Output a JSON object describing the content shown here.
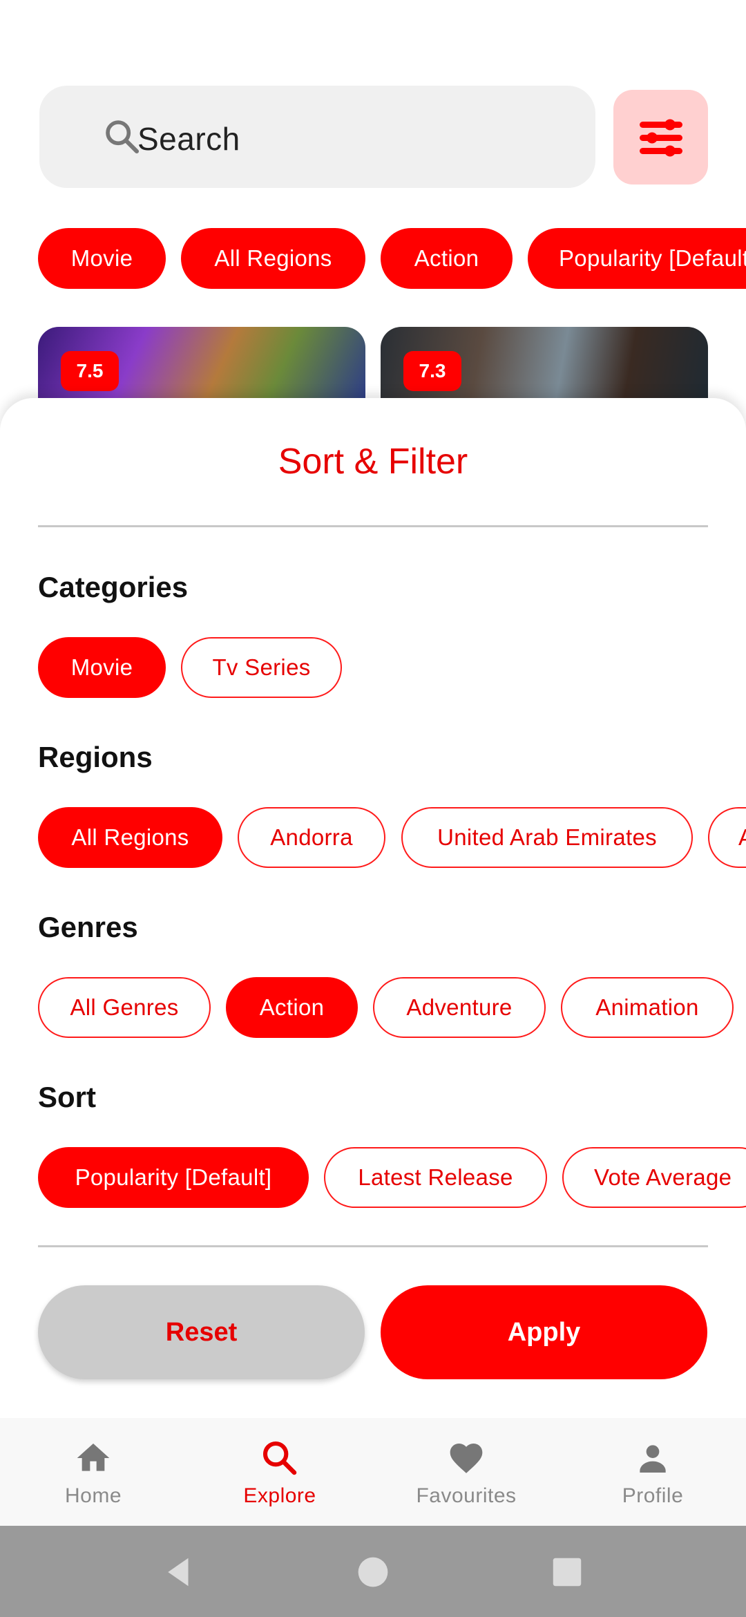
{
  "search": {
    "placeholder": "Search"
  },
  "active_filters": [
    "Movie",
    "All Regions",
    "Action",
    "Popularity [Default]"
  ],
  "posters": [
    {
      "rating": "7.5"
    },
    {
      "rating": "7.3"
    }
  ],
  "sheet": {
    "title": "Sort & Filter",
    "sections": {
      "categories": {
        "title": "Categories",
        "options": [
          "Movie",
          "Tv Series"
        ],
        "selected": "Movie"
      },
      "regions": {
        "title": "Regions",
        "options": [
          "All Regions",
          "Andorra",
          "United Arab Emirates",
          "Afghanistan"
        ],
        "selected": "All Regions"
      },
      "genres": {
        "title": "Genres",
        "options": [
          "All Genres",
          "Action",
          "Adventure",
          "Animation"
        ],
        "selected": "Action"
      },
      "sort": {
        "title": "Sort",
        "options": [
          "Popularity [Default]",
          "Latest Release",
          "Vote Average"
        ],
        "selected": "Popularity [Default]"
      }
    },
    "reset_label": "Reset",
    "apply_label": "Apply"
  },
  "nav": {
    "items": [
      {
        "label": "Home",
        "icon": "home-icon"
      },
      {
        "label": "Explore",
        "icon": "search-icon"
      },
      {
        "label": "Favourites",
        "icon": "heart-icon"
      },
      {
        "label": "Profile",
        "icon": "person-icon"
      }
    ],
    "active": "Explore"
  },
  "colors": {
    "accent": "#ff0000",
    "accent_light": "#ffd0d0",
    "inactive": "#8a8a8a"
  }
}
